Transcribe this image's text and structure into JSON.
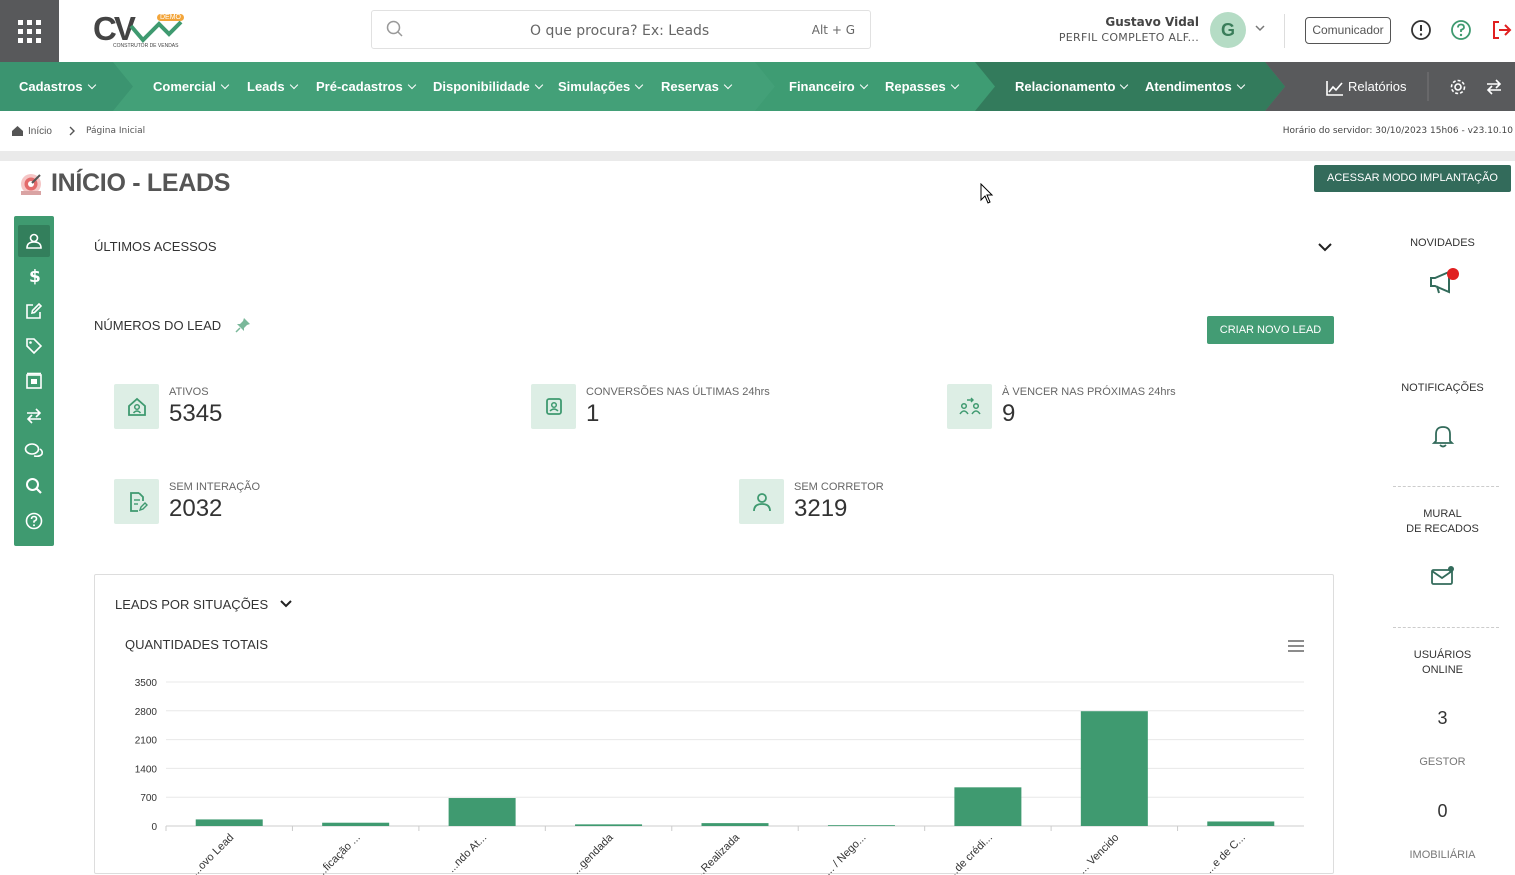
{
  "header": {
    "logo_text": "CV",
    "logo_badge": "DEMO",
    "logo_tagline": "CONSTRUTOR DE VENDAS",
    "search_placeholder": "O que procura? Ex: Leads",
    "search_shortcut": "Alt + G",
    "user_name": "Gustavo Vidal",
    "user_profile": "PERFIL COMPLETO ALF...",
    "avatar_letter": "G",
    "communicator_label": "Comunicador"
  },
  "menu": {
    "items": [
      "Cadastros",
      "Comercial",
      "Leads",
      "Pré-cadastros",
      "Disponibilidade",
      "Simulações",
      "Reservas",
      "Financeiro",
      "Repasses",
      "Relacionamento",
      "Atendimentos"
    ],
    "reports": "Relatórios"
  },
  "breadcrumb": {
    "home": "Início",
    "current": "Página Inicial",
    "server_time": "Horário do servidor: 30/10/2023 15h06 - v23.10.10"
  },
  "page": {
    "title": "INÍCIO - LEADS",
    "implant_button": "ACESSAR MODO IMPLANTAÇÃO"
  },
  "sections": {
    "recent_access": "ÚLTIMOS ACESSOS",
    "lead_numbers": "NÚMEROS DO LEAD",
    "new_lead_button": "CRIAR NOVO LEAD",
    "by_situation": "LEADS POR SITUAÇÕES",
    "totals": "QUANTIDADES TOTAIS"
  },
  "stats": [
    {
      "label": "ATIVOS",
      "value": "5345"
    },
    {
      "label": "CONVERSÕES NAS ÚLTIMAS 24hrs",
      "value": "1"
    },
    {
      "label": "À VENCER NAS PRÓXIMAS 24hrs",
      "value": "9"
    },
    {
      "label": "SEM INTERAÇÃO",
      "value": "2032"
    },
    {
      "label": "SEM CORRETOR",
      "value": "3219"
    }
  ],
  "chart_data": {
    "type": "bar",
    "title": "QUANTIDADES TOTAIS",
    "categories": [
      "...ovo Lead",
      "...ficação ...",
      "...ndo At...",
      "...gendada",
      "...Realizada",
      "... / Nego...",
      "...de crédi...",
      "... Vencido",
      "...e de C..."
    ],
    "values": [
      160,
      80,
      680,
      40,
      70,
      20,
      940,
      2790,
      110
    ],
    "ylim": [
      0,
      3500
    ],
    "yticks": [
      0,
      700,
      1400,
      2100,
      2800,
      3500
    ],
    "grid": true,
    "color": "#3f9a70"
  },
  "right_panel": {
    "news": "NOVIDADES",
    "notifications": "NOTIFICAÇÕES",
    "mural_line1": "MURAL",
    "mural_line2": "DE RECADOS",
    "online_line1": "USUÁRIOS",
    "online_line2": "ONLINE",
    "online_count": "3",
    "gestor_label": "GESTOR",
    "gestor_count": "0",
    "imob_label": "IMOBILIÁRIA"
  },
  "colors": {
    "primary": "#439c74",
    "dark_green": "#336b5b",
    "gray_bar": "#58595b",
    "alert_red": "#e02020"
  }
}
